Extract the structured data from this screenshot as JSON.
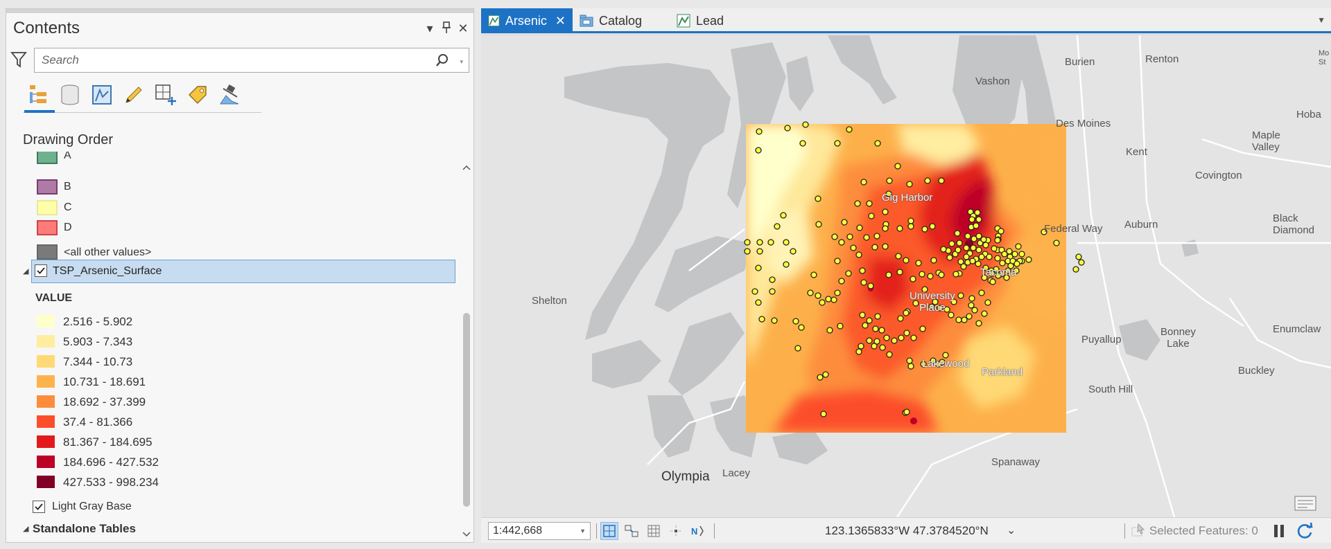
{
  "contents": {
    "title": "Contents",
    "search_placeholder": "Search",
    "drawing_order": "Drawing Order",
    "controls": {
      "dropdown": "▾",
      "pin": "📌",
      "close": "✕"
    },
    "toolbar_icons": [
      "list-by-drawing-order-icon",
      "list-by-data-source-icon",
      "list-by-selection-icon",
      "list-by-editing-icon",
      "list-by-snapping-icon",
      "list-by-labeling-icon",
      "list-by-perspective-imagery-icon"
    ],
    "symbol_classes": [
      {
        "label": "A",
        "fill": "#6fb08e",
        "border": "#3e7a5a"
      },
      {
        "label": "B",
        "fill": "#b07aa6",
        "border": "#7a3c70"
      },
      {
        "label": "C",
        "fill": "#ffffaa",
        "border": "#e8e89a"
      },
      {
        "label": "D",
        "fill": "#ff7b7b",
        "border": "#cc4444"
      },
      {
        "label": "<all other values>",
        "fill": "#7a7a7a",
        "border": "#666666"
      }
    ],
    "layer": {
      "name": "TSP_Arsenic_Surface",
      "checked": true
    },
    "value_heading": "VALUE",
    "value_classes": [
      {
        "label": "2.516 - 5.902",
        "color": "#ffffcc"
      },
      {
        "label": "5.903 - 7.343",
        "color": "#ffeda0"
      },
      {
        "label": "7.344 - 10.73",
        "color": "#fed976"
      },
      {
        "label": "10.731 - 18.691",
        "color": "#feb24c"
      },
      {
        "label": "18.692 - 37.399",
        "color": "#fd8d3c"
      },
      {
        "label": "37.4 - 81.366",
        "color": "#fc4e2a"
      },
      {
        "label": "81.367 - 184.695",
        "color": "#e31a1c"
      },
      {
        "label": "184.696 - 427.532",
        "color": "#bd0026"
      },
      {
        "label": "427.533 - 998.234",
        "color": "#800026"
      }
    ],
    "basemap": {
      "name": "Light Gray Base",
      "checked": true
    },
    "standalone_tables": "Standalone Tables"
  },
  "map_view": {
    "tabs": [
      {
        "label": "Arsenic",
        "active": true,
        "icon": "map-icon"
      },
      {
        "label": "Catalog",
        "active": false,
        "icon": "catalog-icon"
      },
      {
        "label": "Lead",
        "active": false,
        "icon": "map-icon"
      }
    ],
    "places": {
      "burien": "Burien",
      "renton": "Renton",
      "vashon": "Vashon",
      "des_moines": "Des Moines",
      "kent": "Kent",
      "maple_valley": "Maple\nValley",
      "covington": "Covington",
      "auburn": "Auburn",
      "federal_way": "Federal Way",
      "black_diamond": "Black\nDiamond",
      "gig_harbor": "Gig Harbor",
      "tacoma": "Tacoma",
      "university_place": "University\nPlace",
      "shelton": "Shelton",
      "puyallup": "Puyallup",
      "bonney_lake": "Bonney\nLake",
      "enumclaw": "Enumclaw",
      "lakewood": "Lakewood",
      "parkland": "Parkland",
      "buckley": "Buckley",
      "south_hill": "South Hill",
      "spanaway": "Spanaway",
      "olympia": "Olympia",
      "lacey": "Lacey",
      "hoba": "Hoba",
      "mo_st": "Mo\nSt"
    },
    "status": {
      "scale": "1:442,668",
      "coordinates": "123.1365833°W 47.3784520°N",
      "selected_features": "Selected Features: 0"
    }
  }
}
